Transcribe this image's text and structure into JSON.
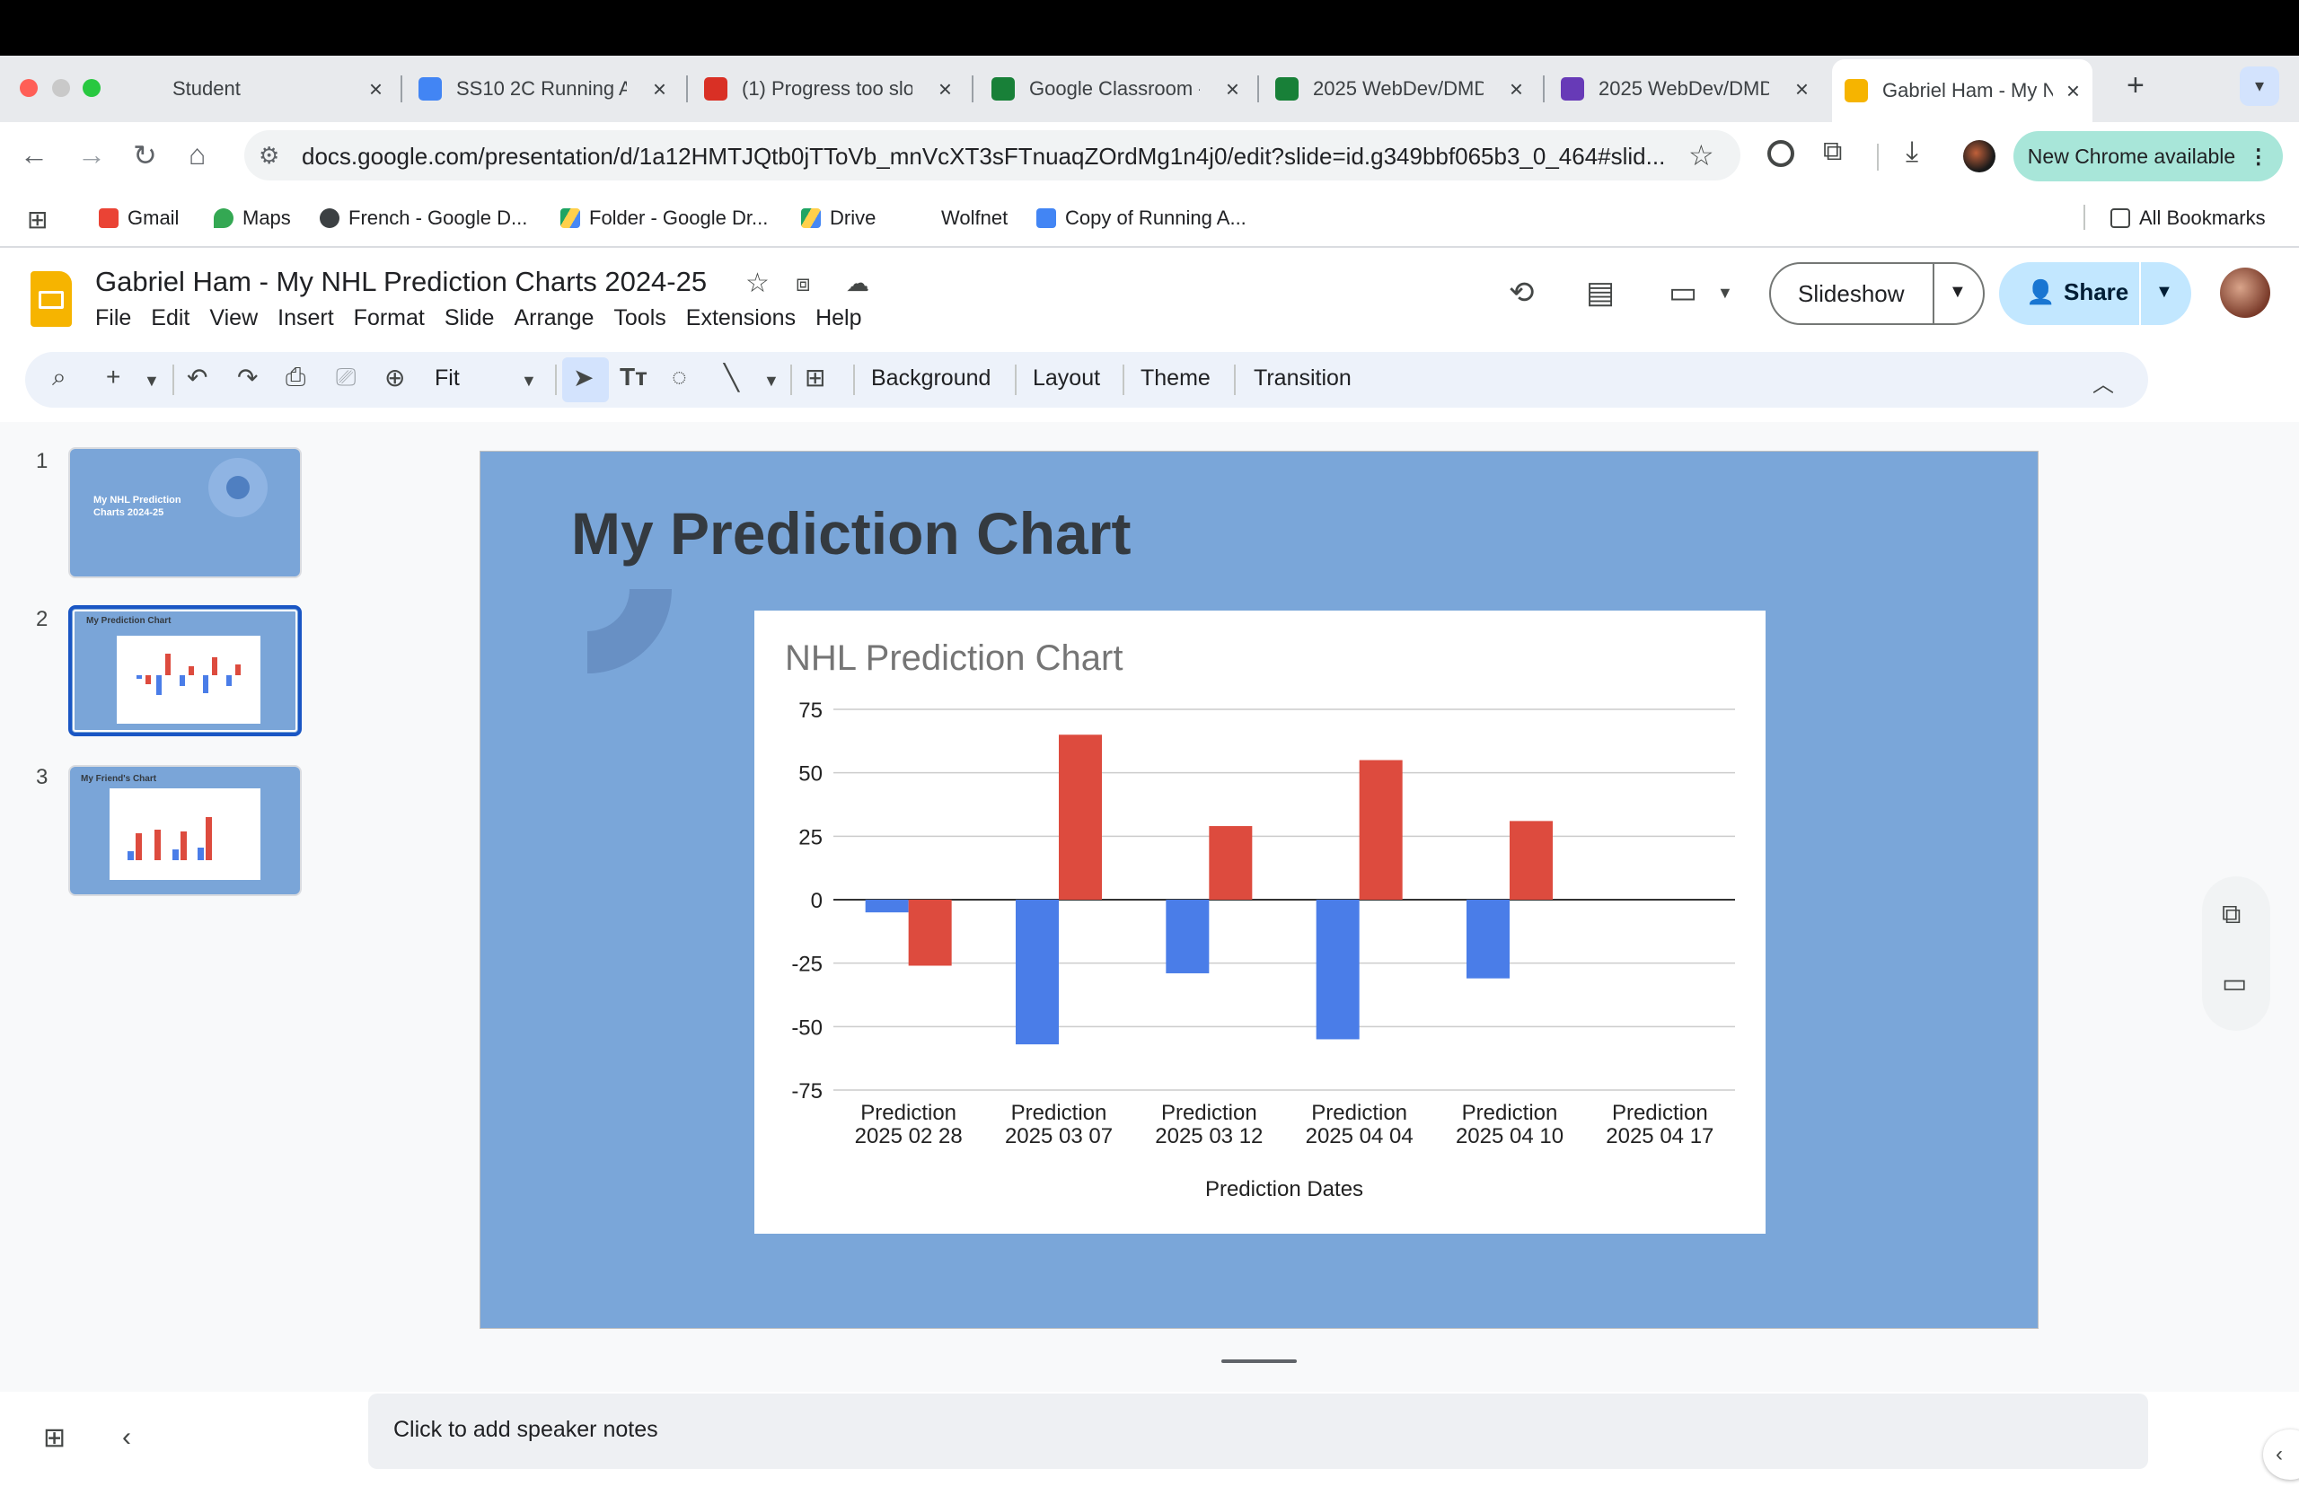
{
  "browser": {
    "tabs": [
      {
        "title": "Student",
        "color": "#e8eaed"
      },
      {
        "title": "SS10 2C Running A",
        "color": "#4285f4"
      },
      {
        "title": "(1) Progress too slo",
        "color": "#d93025"
      },
      {
        "title": "Google Classroom -",
        "color": "#188038"
      },
      {
        "title": "2025 WebDev/DMD",
        "color": "#188038"
      },
      {
        "title": "2025 WebDev/DMD",
        "color": "#673ab7"
      },
      {
        "title": "Gabriel Ham - My N",
        "color": "#f6b400"
      }
    ],
    "new_tab_label": "+",
    "url": "docs.google.com/presentation/d/1a12HMTJQtb0jTToVb_mnVcXT3sFTnuaqZOrdMg1n4j0/edit?slide=id.g349bbf065b3_0_464#slid...",
    "new_chrome_label": "New Chrome available",
    "bookmarks": [
      "Gmail",
      "Maps",
      "French - Google D...",
      "Folder - Google Dr...",
      "Drive",
      "Wolfnet",
      "Copy of Running A..."
    ],
    "all_bookmarks_label": "All Bookmarks"
  },
  "doc": {
    "title": "Gabriel Ham - My NHL Prediction Charts 2024-25",
    "menu": [
      "File",
      "Edit",
      "View",
      "Insert",
      "Format",
      "Slide",
      "Arrange",
      "Tools",
      "Extensions",
      "Help"
    ],
    "slideshow_label": "Slideshow",
    "share_label": "Share"
  },
  "toolbar": {
    "zoom_label": "Fit",
    "background_label": "Background",
    "layout_label": "Layout",
    "theme_label": "Theme",
    "transition_label": "Transition"
  },
  "filmstrip": {
    "numbers": [
      "1",
      "2",
      "3"
    ],
    "thumb1_title": "My NHL Prediction Charts 2024-25",
    "thumb2_title": "My Prediction Chart",
    "thumb3_title": "My Friend's Chart"
  },
  "slide": {
    "title": "My Prediction Chart"
  },
  "chart_data": {
    "type": "bar",
    "title": "NHL Prediction Chart",
    "xlabel": "Prediction Dates",
    "ylabel": "",
    "ylim": [
      -75,
      75
    ],
    "yticks": [
      75,
      50,
      25,
      0,
      -25,
      -50,
      -75
    ],
    "categories": [
      [
        "Prediction",
        "2025 02 28"
      ],
      [
        "Prediction",
        "2025 03 07"
      ],
      [
        "Prediction",
        "2025 03 12"
      ],
      [
        "Prediction",
        "2025 04 04"
      ],
      [
        "Prediction",
        "2025 04 10"
      ],
      [
        "Prediction",
        "2025 04 17"
      ]
    ],
    "series": [
      {
        "color": "#4a7de8",
        "values": [
          -5,
          -57,
          -29,
          -55,
          -31,
          null
        ]
      },
      {
        "color": "#dd4b3e",
        "values": [
          -26,
          65,
          29,
          55,
          31,
          null
        ]
      }
    ],
    "grid": true
  },
  "notes": {
    "placeholder": "Click to add speaker notes"
  },
  "icons": {
    "tab_close": "×",
    "star": "☆"
  }
}
